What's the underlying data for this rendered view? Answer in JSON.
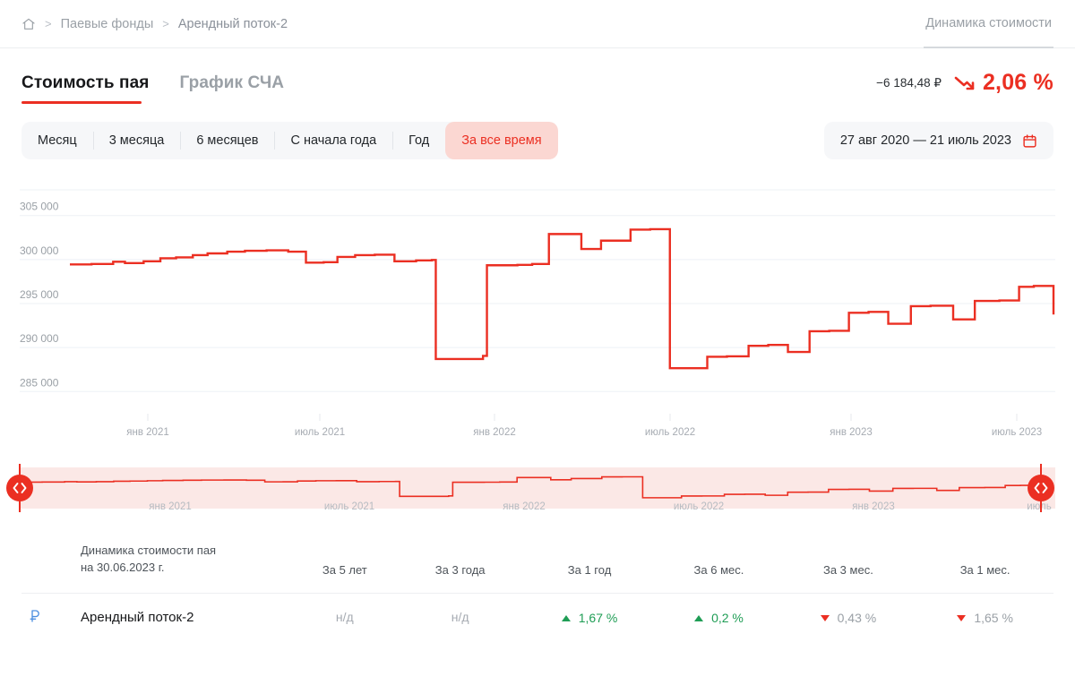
{
  "breadcrumb": {
    "home_icon": "home-icon",
    "sep": ">",
    "items": [
      {
        "label": "Паевые фонды"
      },
      {
        "label": "Арендный поток-2"
      }
    ]
  },
  "topnav": {
    "tab_label": "Динамика стоимости"
  },
  "tabs": [
    {
      "label": "Стоимость пая",
      "active": true
    },
    {
      "label": "График СЧА",
      "active": false
    }
  ],
  "change": {
    "absolute": "−6 184,48 ₽",
    "percent": "2,06 %",
    "direction": "down",
    "color": "#eb2f22"
  },
  "periods": [
    {
      "label": "Месяц",
      "active": false
    },
    {
      "label": "3 месяца",
      "active": false
    },
    {
      "label": "6 месяцев",
      "active": false
    },
    {
      "label": "С начала года",
      "active": false
    },
    {
      "label": "Год",
      "active": false
    },
    {
      "label": "За все время",
      "active": true
    }
  ],
  "daterange": {
    "value": "27 авг 2020 — 21 июль 2023",
    "icon": "calendar-icon",
    "icon_color": "#eb2f22"
  },
  "chart_data": {
    "type": "line",
    "title": "Стоимость пая",
    "xlabel": "",
    "ylabel": "",
    "line_color": "#eb2f22",
    "grid": true,
    "legend": "none",
    "step": true,
    "ylim": [
      283500,
      306500
    ],
    "yticks": [
      285000,
      290000,
      295000,
      300000,
      305000
    ],
    "ytick_labels": [
      "285 000",
      "290 000",
      "295 000",
      "300 000",
      "305 000"
    ],
    "xticks": [
      "янв 2021",
      "июль 2021",
      "янв 2022",
      "июль 2022",
      "янв 2023",
      "июль 2023"
    ],
    "xrange": [
      "27 авг 2020",
      "21 июль 2023"
    ],
    "x": [
      0.0,
      0.022,
      0.044,
      0.056,
      0.075,
      0.092,
      0.108,
      0.125,
      0.14,
      0.16,
      0.178,
      0.2,
      0.222,
      0.24,
      0.258,
      0.272,
      0.29,
      0.31,
      0.33,
      0.352,
      0.368,
      0.372,
      0.398,
      0.42,
      0.424,
      0.455,
      0.47,
      0.487,
      0.5,
      0.52,
      0.54,
      0.545,
      0.57,
      0.59,
      0.61,
      0.628,
      0.648,
      0.668,
      0.69,
      0.71,
      0.73,
      0.752,
      0.772,
      0.792,
      0.812,
      0.832,
      0.855,
      0.875,
      0.898,
      0.92,
      0.945,
      0.965,
      0.98,
      1.0
    ],
    "values": [
      299450,
      299500,
      299750,
      299600,
      299800,
      300150,
      300250,
      300500,
      300700,
      300900,
      301000,
      301050,
      300900,
      299650,
      299700,
      300300,
      300500,
      300550,
      299800,
      299900,
      299950,
      288700,
      288700,
      289050,
      299350,
      299400,
      299500,
      302900,
      302900,
      301200,
      302150,
      302150,
      303400,
      303450,
      287650,
      287650,
      288950,
      289000,
      290200,
      290300,
      289500,
      291850,
      291900,
      293950,
      294050,
      292700,
      294700,
      294750,
      293200,
      295300,
      295350,
      296900,
      297000,
      293750
    ]
  },
  "minimap": {
    "selection_color": "#fbe8e6",
    "line_color": "#eb2f22",
    "handle_color": "#eb2f22",
    "handle_glyph": "‹›",
    "labels": [
      "янв 2021",
      "июль 2021",
      "янв 2022",
      "июль 2022",
      "янв 2023",
      "июль"
    ]
  },
  "table": {
    "title": "Динамика стоимости пая",
    "subtitle": "на 30.06.2023 г.",
    "columns": [
      {
        "label": "За 5 лет"
      },
      {
        "label": "За 3 года"
      },
      {
        "label": "За 1 год"
      },
      {
        "label": "За 6 мес."
      },
      {
        "label": "За 3 мес."
      },
      {
        "label": "За 1 мес."
      }
    ],
    "rows": [
      {
        "icon": "ruble-icon",
        "icon_color": "#4d8fe0",
        "name": "Арендный поток-2",
        "cells": [
          {
            "value": "н/д",
            "dir": "none"
          },
          {
            "value": "н/д",
            "dir": "none"
          },
          {
            "value": "1,67 %",
            "dir": "up"
          },
          {
            "value": "0,2 %",
            "dir": "up"
          },
          {
            "value": "0,43 %",
            "dir": "down"
          },
          {
            "value": "1,65 %",
            "dir": "down"
          }
        ]
      }
    ]
  }
}
